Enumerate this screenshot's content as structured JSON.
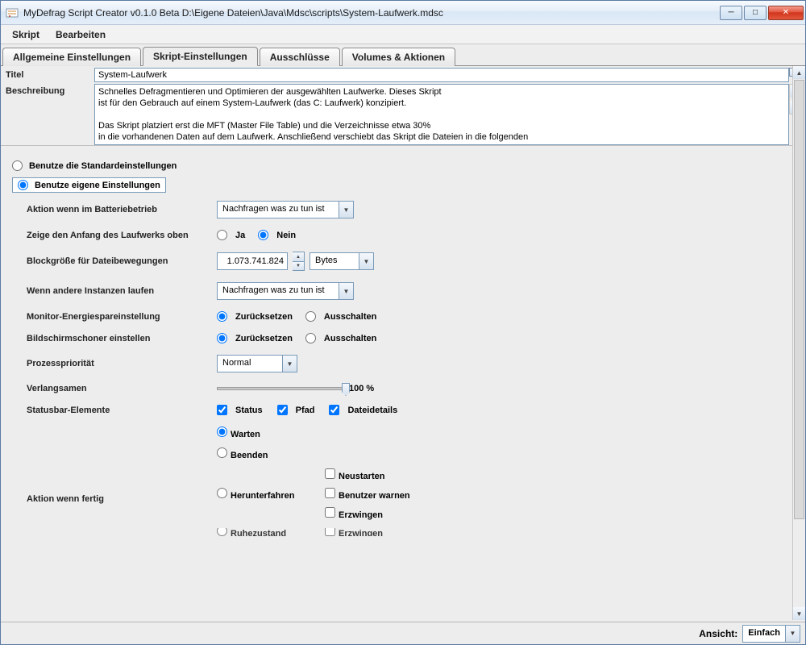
{
  "window": {
    "title": "MyDefrag Script Creator v0.1.0 Beta D:\\Eigene Dateien\\Java\\Mdsc\\scripts\\System-Laufwerk.mdsc"
  },
  "menu": {
    "script": "Skript",
    "edit": "Bearbeiten"
  },
  "tabs": {
    "general": "Allgemeine Einstellungen",
    "script": "Skript-Einstellungen",
    "excludes": "Ausschlüsse",
    "volumes": "Volumes & Aktionen"
  },
  "fields": {
    "title_label": "Titel",
    "title_value": "System-Laufwerk",
    "desc_label": "Beschreibung",
    "desc_value": "Schnelles Defragmentieren und Optimieren der ausgewählten Laufwerke. Dieses Skript\nist für den Gebrauch auf einem System-Laufwerk (das C: Laufwerk) konzipiert.\n\nDas Skript platziert erst die MFT (Master File Table) und die Verzeichnisse etwa 30%\nin die vorhandenen Daten auf dem Laufwerk. Anschließend verschiebt das Skript die Dateien in die folgenden"
  },
  "mode": {
    "default": "Benutze die Standardeinstellungen",
    "custom": "Benutze eigene Einstellungen"
  },
  "rows": {
    "battery_label": "Aktion wenn im Batteriebetrieb",
    "battery_value": "Nachfragen was zu tun ist",
    "showtop_label": "Zeige den Anfang des Laufwerks oben",
    "yes": "Ja",
    "no": "Nein",
    "blocksize_label": "Blockgröße für Dateibewegungen",
    "blocksize_value": "1.073.741.824",
    "blocksize_unit": "Bytes",
    "other_label": "Wenn andere Instanzen laufen",
    "other_value": "Nachfragen was zu tun ist",
    "power_label": "Monitor-Energiespareinstellung",
    "reset": "Zurücksetzen",
    "off": "Ausschalten",
    "screensaver_label": "Bildschirmschoner einstellen",
    "priority_label": "Prozesspriorität",
    "priority_value": "Normal",
    "slowdown_label": "Verlangsamen",
    "slowdown_value": "100 %",
    "statusbar_label": "Statusbar-Elemente",
    "status": "Status",
    "path": "Pfad",
    "filedetails": "Dateidetails",
    "wait": "Warten",
    "quit": "Beenden",
    "shutdown": "Herunterfahren",
    "restart": "Neustarten",
    "warnuser": "Benutzer warnen",
    "force": "Erzwingen",
    "hibernate": "Ruhezustand",
    "force2": "Erzwingen",
    "finished_label": "Aktion wenn fertig"
  },
  "footer": {
    "view_label": "Ansicht:",
    "view_value": "Einfach"
  }
}
